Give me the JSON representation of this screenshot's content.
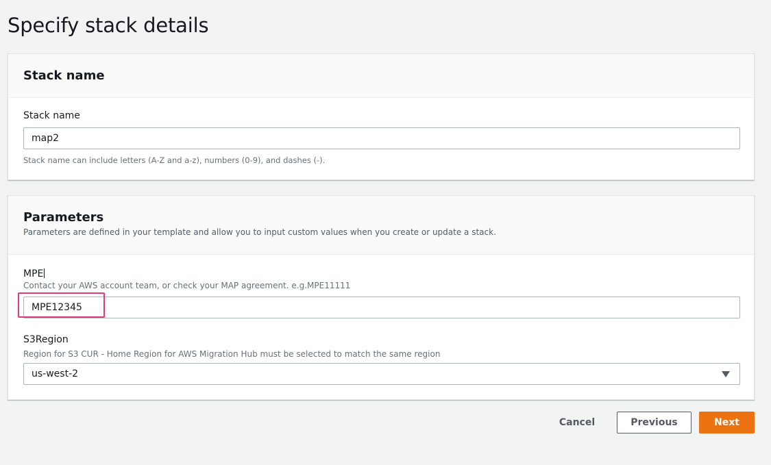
{
  "page": {
    "title": "Specify stack details"
  },
  "stack_panel": {
    "title": "Stack name",
    "field_label": "Stack name",
    "value": "map2",
    "help_text": "Stack name can include letters (A-Z and a-z), numbers (0-9), and dashes (-)."
  },
  "parameters_panel": {
    "title": "Parameters",
    "description": "Parameters are defined in your template and allow you to input custom values when you create or update a stack.",
    "mpe": {
      "label": "MPE",
      "description": "Contact your AWS account team, or check your MAP agreement. e.g.MPE11111",
      "value": "MPE12345"
    },
    "s3region": {
      "label": "S3Region",
      "description": "Region for S3 CUR - Home Region for AWS Migration Hub must be selected to match the same region",
      "selected": "us-west-2"
    }
  },
  "actions": {
    "cancel": "Cancel",
    "previous": "Previous",
    "next": "Next"
  },
  "colors": {
    "primary_button": "#ec7211",
    "highlight": "#e8367b",
    "background": "#f2f3f3"
  },
  "icons": {
    "select_caret": "caret-down-icon"
  }
}
